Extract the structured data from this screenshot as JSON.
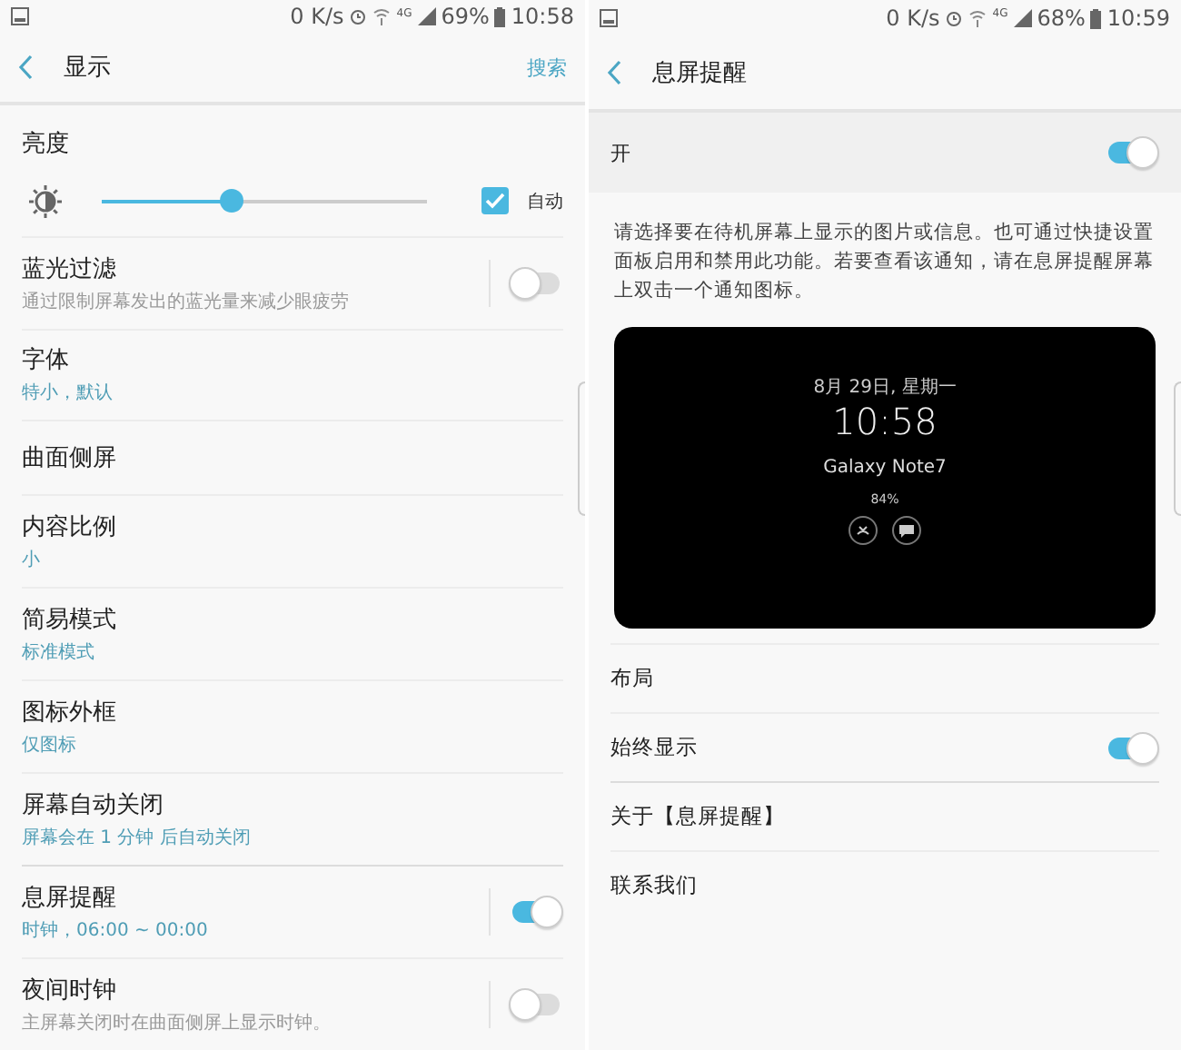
{
  "left_screen": {
    "status_bar": {
      "speed": "0 K/s",
      "network": "4G",
      "battery": "69%",
      "time": "10:58"
    },
    "header": {
      "title": "显示",
      "action": "搜索"
    },
    "brightness": {
      "title": "亮度",
      "level": 0.4,
      "auto": {
        "label": "自动",
        "checked": true
      }
    },
    "settings": [
      {
        "kind": "toggle",
        "title": "蓝光过滤",
        "subtitle": "通过限制屏幕发出的蓝光量来减少眼疲劳",
        "on": false
      },
      {
        "kind": "plain",
        "title": "字体",
        "subtitle": "特小，默认"
      },
      {
        "kind": "plain",
        "title": "曲面侧屏"
      },
      {
        "kind": "plain",
        "title": "内容比例",
        "subtitle": "小"
      },
      {
        "kind": "plain",
        "title": "简易模式",
        "subtitle": "标准模式"
      },
      {
        "kind": "plain",
        "title": "图标外框",
        "subtitle": "仅图标"
      },
      {
        "kind": "plain",
        "title": "屏幕自动关闭",
        "subtitle": "屏幕会在 1 分钟 后自动关闭"
      },
      {
        "kind": "toggle",
        "title": "息屏提醒",
        "subtitle": "时钟，06:00 ~ 00:00",
        "on": true
      },
      {
        "kind": "toggle",
        "title": "夜间时钟",
        "subtitle": "主屏幕关闭时在曲面侧屏上显示时钟。",
        "on": false
      }
    ]
  },
  "right_screen": {
    "status_bar": {
      "speed": "0 K/s",
      "network": "4G",
      "battery": "68%",
      "time": "10:59"
    },
    "header": {
      "title": "息屏提醒"
    },
    "master": {
      "label": "开",
      "on": true
    },
    "description": "请选择要在待机屏幕上显示的图片或信息。也可通过快捷设置面板启用和禁用此功能。若要查看该通知，请在息屏提醒屏幕上双击一个通知图标。",
    "preview": {
      "date": "8月 29日, 星期一",
      "time": "10:58",
      "device": "Galaxy Note7",
      "battery": "84%"
    },
    "items": [
      {
        "kind": "plain",
        "label": "布局"
      },
      {
        "kind": "toggle",
        "label": "始终显示",
        "on": true
      },
      {
        "kind": "plain",
        "label": "关于【息屏提醒】"
      },
      {
        "kind": "plain",
        "label": "联系我们"
      }
    ]
  }
}
